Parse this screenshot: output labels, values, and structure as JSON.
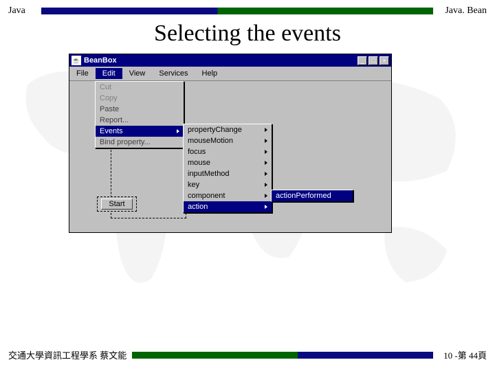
{
  "header": {
    "left": "Java",
    "right": "Java. Bean"
  },
  "title": "Selecting the events",
  "beanbox": {
    "window_title": "BeanBox",
    "menubar": [
      "File",
      "Edit",
      "View",
      "Services",
      "Help"
    ],
    "edit_menu": {
      "items": [
        {
          "label": "Cut",
          "disabled": true
        },
        {
          "label": "Copy",
          "disabled": true
        },
        {
          "label": "Paste",
          "disabled": false
        },
        {
          "label": "Report...",
          "disabled": false
        },
        {
          "label": "Events",
          "submenu": true,
          "selected": true
        },
        {
          "label": "Bind property...",
          "disabled": false
        }
      ]
    },
    "events_submenu": [
      {
        "label": "propertyChange",
        "submenu": true
      },
      {
        "label": "mouseMotion",
        "submenu": true
      },
      {
        "label": "focus",
        "submenu": true
      },
      {
        "label": "mouse",
        "submenu": true
      },
      {
        "label": "inputMethod",
        "submenu": true
      },
      {
        "label": "key",
        "submenu": true
      },
      {
        "label": "component",
        "submenu": true
      },
      {
        "label": "action",
        "submenu": true,
        "selected": true
      }
    ],
    "action_submenu": [
      {
        "label": "actionPerformed",
        "selected": true
      }
    ],
    "start_button": "Start"
  },
  "footer": {
    "left": "交通大學資訊工程學系 蔡文能",
    "right": "10 -第 44頁"
  }
}
